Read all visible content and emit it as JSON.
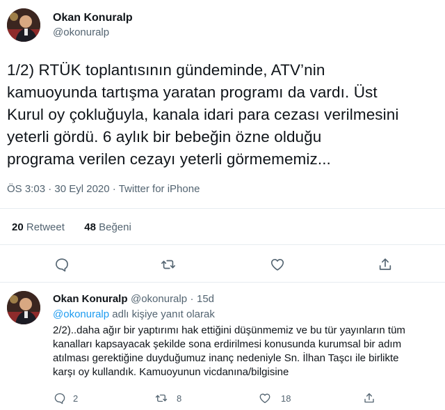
{
  "tweet": {
    "author_name": "Okan Konuralp",
    "author_handle": "@okonuralp",
    "text_lines": [
      "1/2) RTÜK toplantısının gündeminde, ATV’nin",
      "kamuoyunda tartışma yaratan programı da vardı. Üst",
      "Kurul oy çokluğuyla, kanala idari para cezası verilmesini",
      "yeterli gördü. 6 aylık bir bebeğin özne olduğu",
      "programa verilen cezayı yeterli görmememiz..."
    ],
    "time": "ÖS 3:03",
    "date": "30 Eyl 2020",
    "separator": "·",
    "source": "Twitter for iPhone",
    "retweet_count": "20",
    "retweet_label": "Retweet",
    "like_count": "48",
    "like_label": "Beğeni",
    "actions": [
      "reply-icon",
      "retweet-icon",
      "like-icon",
      "share-icon"
    ]
  },
  "reply": {
    "author_name": "Okan Konuralp",
    "author_handle": "@okonuralp",
    "separator": "·",
    "age": "15d",
    "replying_to_handle": "@okonuralp",
    "replying_to_suffix": "adlı kişiye yanıt olarak",
    "text_lines": [
      "2/2)..daha ağır bir yaptırımı hak ettiğini düşünmemiz ve bu tür yayınların tüm",
      "kanalları kapsayacak şekilde sona erdirilmesi konusunda kurumsal bir adım",
      "atılması gerektiğine duyduğumuz inanç nedeniyle Sn. İlhan Taşcı ile birlikte",
      "karşı oy kullandık. Kamuoyunun vicdanına/bilgisine"
    ],
    "reply_count": "2",
    "retweet_count": "8",
    "like_count": "18"
  },
  "colors": {
    "text_primary": "#0f1419",
    "text_secondary": "#536471",
    "link": "#1d9bf0",
    "divider": "#e6ecf0"
  }
}
